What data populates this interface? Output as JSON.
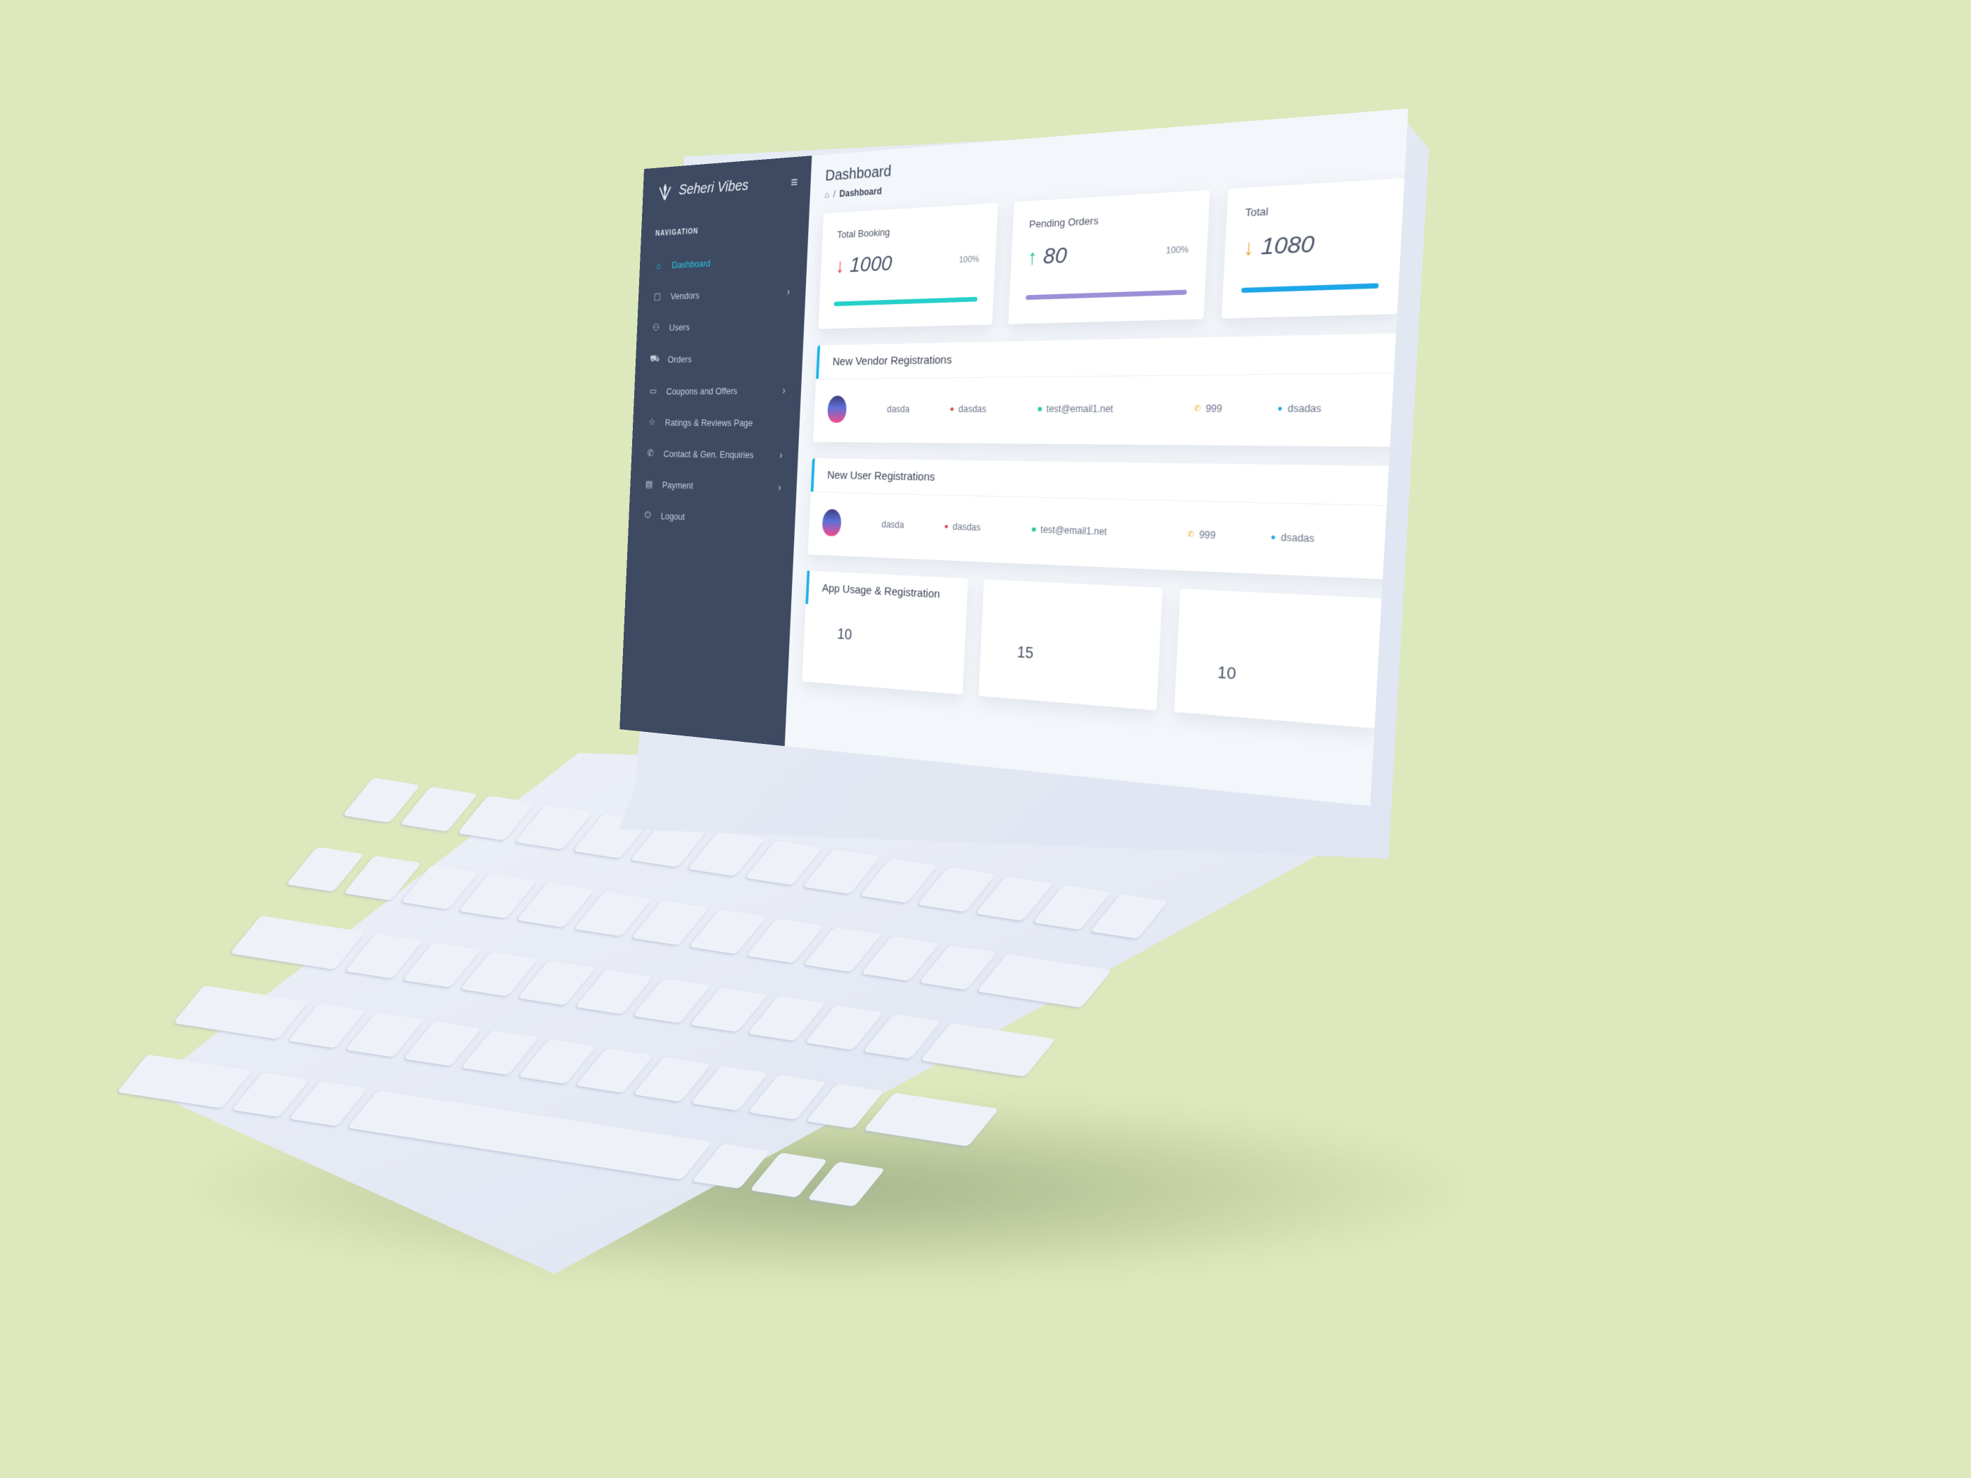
{
  "app": {
    "brand": "Seheri Vibes",
    "menu_toggle_icon": "menu-toggle-icon"
  },
  "sidebar": {
    "heading": "NAVIGATION",
    "items": [
      {
        "label": "Dashboard",
        "icon": "home-icon",
        "active": true,
        "has_children": false
      },
      {
        "label": "Vendors",
        "icon": "store-icon",
        "active": false,
        "has_children": true
      },
      {
        "label": "Users",
        "icon": "user-icon",
        "active": false,
        "has_children": false
      },
      {
        "label": "Orders",
        "icon": "cart-icon",
        "active": false,
        "has_children": false
      },
      {
        "label": "Coupons and Offers",
        "icon": "file-icon",
        "active": false,
        "has_children": true
      },
      {
        "label": "Ratings & Reviews Page",
        "icon": "star-icon",
        "active": false,
        "has_children": false
      },
      {
        "label": "Contact & Gen. Enquiries",
        "icon": "phone-icon",
        "active": false,
        "has_children": true
      },
      {
        "label": "Payment",
        "icon": "card-icon",
        "active": false,
        "has_children": true
      },
      {
        "label": "Logout",
        "icon": "power-icon",
        "active": false,
        "has_children": false
      }
    ]
  },
  "header": {
    "title": "Dashboard",
    "breadcrumb": {
      "home_icon": "home-icon",
      "separator": "/",
      "current": "Dashboard"
    }
  },
  "stats": [
    {
      "label": "Total Booking",
      "value": "1000",
      "percent": "100%",
      "trend": "down",
      "arrow_color": "#e8424a",
      "fill": 1.0,
      "bar_color": "#25d0c8"
    },
    {
      "label": "Pending Orders",
      "value": "80",
      "percent": "100%",
      "trend": "up",
      "arrow_color": "#25c6a0",
      "fill": 1.0,
      "bar_color": "#9b8fd6"
    },
    {
      "label": "Total",
      "value": "1080",
      "percent": "",
      "trend": "down",
      "arrow_color": "#f0a83a",
      "fill": 1.0,
      "bar_color": "#1da6e8"
    }
  ],
  "vendor_panel": {
    "title": "New Vendor Registrations",
    "row": {
      "name": "dasda",
      "field_a": "dasdas",
      "email": "test@email1.net",
      "phone": "999",
      "location": "dsadas"
    }
  },
  "user_panel": {
    "title": "New User Registrations",
    "row": {
      "name": "dasda",
      "field_a": "dasdas",
      "email": "test@email1.net",
      "phone": "999",
      "location": "dsadas"
    }
  },
  "app_usage": {
    "title": "App Usage & Registration",
    "ticks": [
      "10",
      "15",
      "10"
    ]
  },
  "colors": {
    "sidebar_bg": "#3d4a62",
    "accent": "#25c6dc",
    "background": "#dde8bc"
  }
}
